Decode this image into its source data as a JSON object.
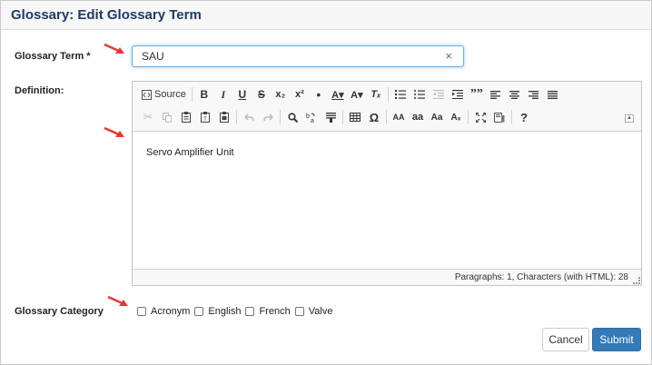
{
  "dialog": {
    "title": "Glossary: Edit Glossary Term"
  },
  "term": {
    "label": "Glossary Term *",
    "value": "SAU",
    "clear_icon": "×"
  },
  "definition": {
    "label": "Definition:",
    "toolbar": {
      "source_label": "Source",
      "bold": "B",
      "italic": "I",
      "underline": "U",
      "strike": "S",
      "subscript": "x₂",
      "superscript": "x²",
      "bullet_dot": "•",
      "font_color": "A▾",
      "bg_color": "A▾",
      "remove_format": "Tₓ",
      "blockquote": "””",
      "special_char": "Ω",
      "upper_case": "AA",
      "lower_case": "aa",
      "title_case": "Aa",
      "toggle_case": "Aₓ",
      "help": "?"
    },
    "content": "Servo Amplifier Unit",
    "status": "Paragraphs: 1, Characters (with HTML): 28"
  },
  "category": {
    "label": "Glossary Category",
    "options": [
      "Acronym",
      "English",
      "French",
      "Valve"
    ]
  },
  "buttons": {
    "cancel": "Cancel",
    "submit": "Submit"
  },
  "colors": {
    "title": "#1f3b64",
    "submit_bg": "#337ab7",
    "arrow": "#e53935",
    "focus": "#66afe9"
  },
  "icons": [
    "close-icon",
    "source-icon",
    "undo-icon",
    "redo-icon",
    "find-icon",
    "replace-icon",
    "table-icon",
    "maximize-icon",
    "preview-icon",
    "arrow-pointer-icon"
  ]
}
